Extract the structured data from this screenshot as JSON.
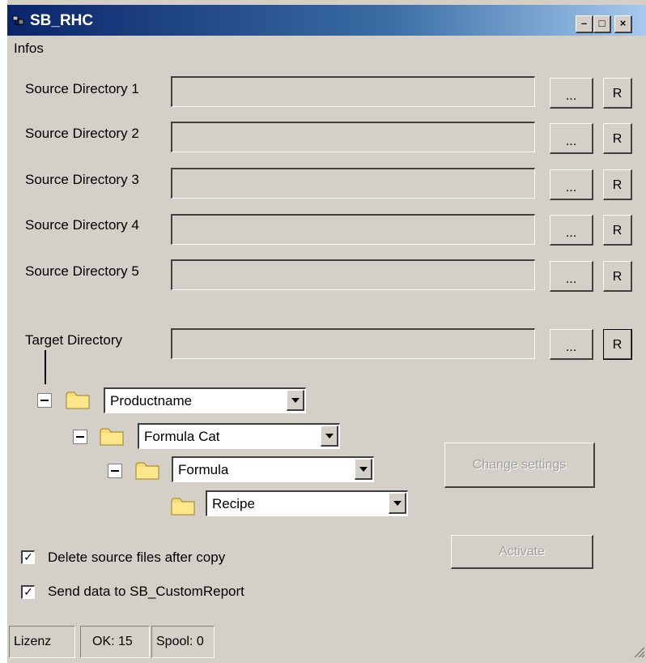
{
  "window": {
    "title": "SB_RHC",
    "colors": {
      "titlebar_start": "#0a246a",
      "titlebar_end": "#a6caf0",
      "face": "#d4d0c8"
    }
  },
  "menu": {
    "items": [
      "Infos"
    ]
  },
  "sources": [
    {
      "label": "Source Directory 1",
      "value": "",
      "browse_label": "...",
      "reset_label": "R"
    },
    {
      "label": "Source Directory 2",
      "value": "",
      "browse_label": "...",
      "reset_label": "R"
    },
    {
      "label": "Source Directory 3",
      "value": "",
      "browse_label": "...",
      "reset_label": "R"
    },
    {
      "label": "Source Directory 4",
      "value": "",
      "browse_label": "...",
      "reset_label": "R"
    },
    {
      "label": "Source Directory 5",
      "value": "",
      "browse_label": "...",
      "reset_label": "R"
    }
  ],
  "target": {
    "label": "Target Directory",
    "value": "",
    "browse_label": "...",
    "reset_label": "R"
  },
  "tree": [
    {
      "value": "Productname",
      "icon": "folder-icon"
    },
    {
      "value": "Formula Cat",
      "icon": "folder-icon"
    },
    {
      "value": "Formula",
      "icon": "folder-icon"
    },
    {
      "value": "Recipe",
      "icon": "folder-icon"
    }
  ],
  "actions": {
    "change_settings": "Change settings",
    "activate": "Activate"
  },
  "options": {
    "delete_source": {
      "label": "Delete source files after copy",
      "checked": true
    },
    "send_data": {
      "label": "Send data to SB_CustomReport",
      "checked": true
    }
  },
  "status": {
    "license": "Lizenz",
    "ok": "OK: 15",
    "spool": "Spool: 0"
  }
}
